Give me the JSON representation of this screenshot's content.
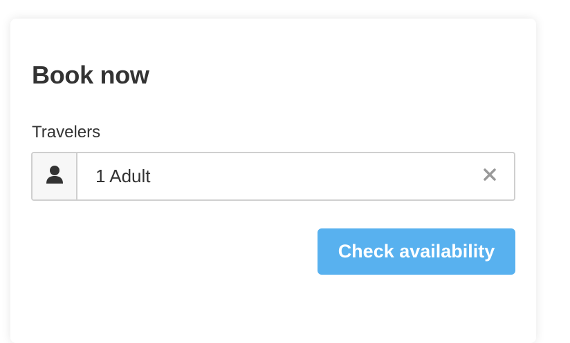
{
  "booking": {
    "title": "Book now",
    "travelers_label": "Travelers",
    "travelers_value": "1 Adult",
    "check_button": "Check availability"
  },
  "icons": {
    "addon": "person-icon",
    "clear": "close-icon"
  },
  "colors": {
    "button": "#58b1ef",
    "text": "#333333",
    "border": "#cfcfcf",
    "clear_icon": "#999999"
  }
}
